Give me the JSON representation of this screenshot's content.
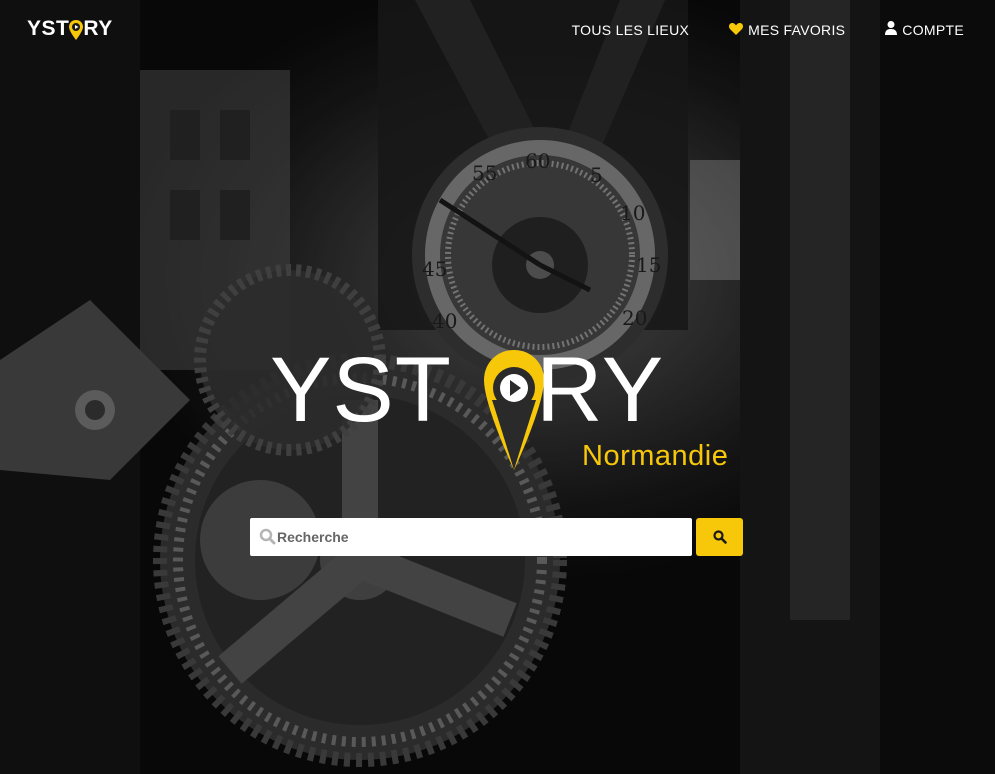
{
  "navbar": {
    "logo_left": "YST",
    "logo_right": "RY",
    "links": [
      {
        "label": "TOUS LES LIEUX",
        "icon": ""
      },
      {
        "label": "MES FAVORIS",
        "icon": "heart-icon"
      },
      {
        "label": "COMPTE",
        "icon": "user-icon"
      }
    ]
  },
  "hero": {
    "word_left": "YST",
    "word_right": "RY",
    "subtitle": "Normandie"
  },
  "search": {
    "placeholder": "Recherche",
    "button_icon": "search-icon"
  },
  "colors": {
    "accent": "#f7c70a",
    "text": "#ffffff",
    "pin_dark": "#2a2a2a"
  }
}
